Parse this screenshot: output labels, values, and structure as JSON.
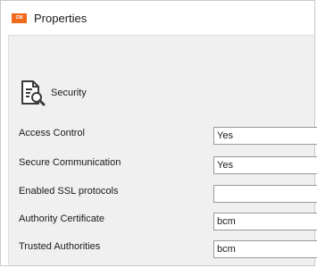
{
  "window": {
    "title": "Properties",
    "app_icon_text": "CM",
    "app_icon_color": "#f06a1e"
  },
  "section": {
    "title": "Security",
    "icon": "document-search-icon"
  },
  "fields": [
    {
      "label": "Access Control",
      "value": "Yes"
    },
    {
      "label": "Secure Communication",
      "value": "Yes"
    },
    {
      "label": "Enabled SSL protocols",
      "value": ""
    },
    {
      "label": "Authority Certificate",
      "value": "bcm"
    },
    {
      "label": "Trusted Authorities",
      "value": "bcm"
    }
  ]
}
